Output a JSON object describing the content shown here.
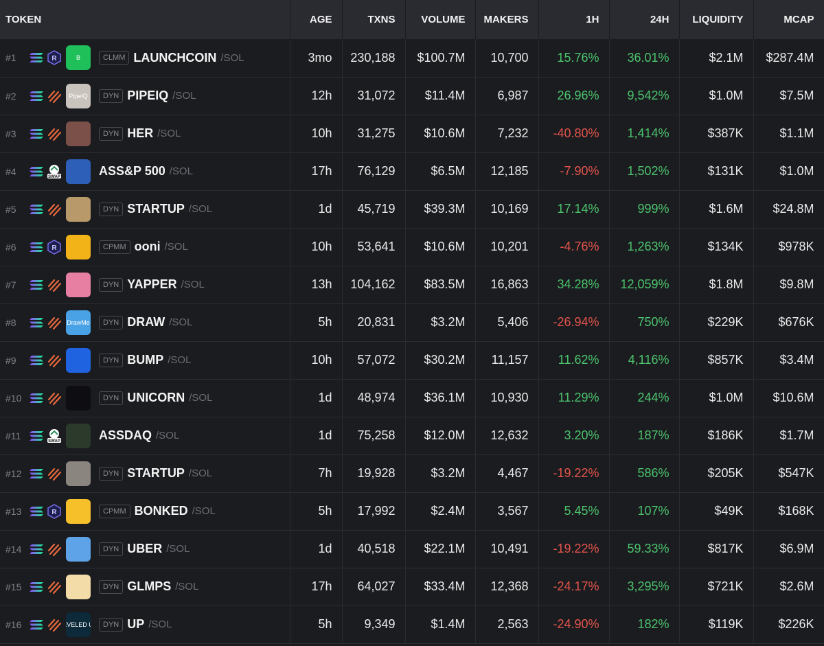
{
  "headers": [
    "TOKEN",
    "AGE",
    "TXNS",
    "VOLUME",
    "MAKERS",
    "1H",
    "24H",
    "LIQUIDITY",
    "MCAP"
  ],
  "colors": {
    "positive": "#4cc46d",
    "negative": "#e5544b"
  },
  "rows": [
    {
      "rank": "#1",
      "dex": "raydium-icon",
      "pool": "CLMM",
      "symbol": "LAUNCHCOIN",
      "quote": "/SOL",
      "age": "3mo",
      "txns": "230,188",
      "volume": "$100.7M",
      "makers": "10,700",
      "h1": "15.76%",
      "h24": "36.01%",
      "liquidity": "$2.1M",
      "mcap": "$287.4M",
      "avatar": "#1fc05a",
      "avatar_text": "B"
    },
    {
      "rank": "#2",
      "dex": "meteora-icon",
      "pool": "DYN",
      "symbol": "PIPEIQ",
      "quote": "/SOL",
      "age": "12h",
      "txns": "31,072",
      "volume": "$11.4M",
      "makers": "6,987",
      "h1": "26.96%",
      "h24": "9,542%",
      "liquidity": "$1.0M",
      "mcap": "$7.5M",
      "avatar": "#c9c3bd",
      "avatar_text": "PipeIQ"
    },
    {
      "rank": "#3",
      "dex": "meteora-icon",
      "pool": "DYN",
      "symbol": "HER",
      "quote": "/SOL",
      "age": "10h",
      "txns": "31,275",
      "volume": "$10.6M",
      "makers": "7,232",
      "h1": "-40.80%",
      "h24": "1,414%",
      "liquidity": "$387K",
      "mcap": "$1.1M",
      "avatar": "#7a5048",
      "avatar_text": ""
    },
    {
      "rank": "#4",
      "dex": "swap-icon",
      "pool": "",
      "symbol": "ASS&P 500",
      "quote": "/SOL",
      "age": "17h",
      "txns": "76,129",
      "volume": "$6.5M",
      "makers": "12,185",
      "h1": "-7.90%",
      "h24": "1,502%",
      "liquidity": "$131K",
      "mcap": "$1.0M",
      "avatar": "#2d5fb8",
      "avatar_text": ""
    },
    {
      "rank": "#5",
      "dex": "meteora-icon",
      "pool": "DYN",
      "symbol": "STARTUP",
      "quote": "/SOL",
      "age": "1d",
      "txns": "45,719",
      "volume": "$39.3M",
      "makers": "10,169",
      "h1": "17.14%",
      "h24": "999%",
      "liquidity": "$1.6M",
      "mcap": "$24.8M",
      "avatar": "#b89a6a",
      "avatar_text": ""
    },
    {
      "rank": "#6",
      "dex": "raydium-icon",
      "pool": "CPMM",
      "symbol": "ooni",
      "quote": "/SOL",
      "age": "10h",
      "txns": "53,641",
      "volume": "$10.6M",
      "makers": "10,201",
      "h1": "-4.76%",
      "h24": "1,263%",
      "liquidity": "$134K",
      "mcap": "$978K",
      "avatar": "#f2b318",
      "avatar_text": ""
    },
    {
      "rank": "#7",
      "dex": "meteora-icon",
      "pool": "DYN",
      "symbol": "YAPPER",
      "quote": "/SOL",
      "age": "13h",
      "txns": "104,162",
      "volume": "$83.5M",
      "makers": "16,863",
      "h1": "34.28%",
      "h24": "12,059%",
      "liquidity": "$1.8M",
      "mcap": "$9.8M",
      "avatar": "#e77fa3",
      "avatar_text": ""
    },
    {
      "rank": "#8",
      "dex": "meteora-icon",
      "pool": "DYN",
      "symbol": "DRAW",
      "quote": "/SOL",
      "age": "5h",
      "txns": "20,831",
      "volume": "$3.2M",
      "makers": "5,406",
      "h1": "-26.94%",
      "h24": "750%",
      "liquidity": "$229K",
      "mcap": "$676K",
      "avatar": "#4aa2e6",
      "avatar_text": "DrawMe"
    },
    {
      "rank": "#9",
      "dex": "meteora-icon",
      "pool": "DYN",
      "symbol": "BUMP",
      "quote": "/SOL",
      "age": "10h",
      "txns": "57,072",
      "volume": "$30.2M",
      "makers": "11,157",
      "h1": "11.62%",
      "h24": "4,116%",
      "liquidity": "$857K",
      "mcap": "$3.4M",
      "avatar": "#1f63e0",
      "avatar_text": ""
    },
    {
      "rank": "#10",
      "dex": "meteora-icon",
      "pool": "DYN",
      "symbol": "UNICORN",
      "quote": "/SOL",
      "age": "1d",
      "txns": "48,974",
      "volume": "$36.1M",
      "makers": "10,930",
      "h1": "11.29%",
      "h24": "244%",
      "liquidity": "$1.0M",
      "mcap": "$10.6M",
      "avatar": "#0d0d12",
      "avatar_text": ""
    },
    {
      "rank": "#11",
      "dex": "swap-icon",
      "pool": "",
      "symbol": "ASSDAQ",
      "quote": "/SOL",
      "age": "1d",
      "txns": "75,258",
      "volume": "$12.0M",
      "makers": "12,632",
      "h1": "3.20%",
      "h24": "187%",
      "liquidity": "$186K",
      "mcap": "$1.7M",
      "avatar": "#2b3a2a",
      "avatar_text": ""
    },
    {
      "rank": "#12",
      "dex": "meteora-icon",
      "pool": "DYN",
      "symbol": "STARTUP",
      "quote": "/SOL",
      "age": "7h",
      "txns": "19,928",
      "volume": "$3.2M",
      "makers": "4,467",
      "h1": "-19.22%",
      "h24": "586%",
      "liquidity": "$205K",
      "mcap": "$547K",
      "avatar": "#8b8580",
      "avatar_text": ""
    },
    {
      "rank": "#13",
      "dex": "raydium-icon",
      "pool": "CPMM",
      "symbol": "BONKED",
      "quote": "/SOL",
      "age": "5h",
      "txns": "17,992",
      "volume": "$2.4M",
      "makers": "3,567",
      "h1": "5.45%",
      "h24": "107%",
      "liquidity": "$49K",
      "mcap": "$168K",
      "avatar": "#f5c02a",
      "avatar_text": ""
    },
    {
      "rank": "#14",
      "dex": "meteora-icon",
      "pool": "DYN",
      "symbol": "UBER",
      "quote": "/SOL",
      "age": "1d",
      "txns": "40,518",
      "volume": "$22.1M",
      "makers": "10,491",
      "h1": "-19.22%",
      "h24": "59.33%",
      "liquidity": "$817K",
      "mcap": "$6.9M",
      "avatar": "#5ea3e8",
      "avatar_text": ""
    },
    {
      "rank": "#15",
      "dex": "meteora-icon",
      "pool": "DYN",
      "symbol": "GLMPS",
      "quote": "/SOL",
      "age": "17h",
      "txns": "64,027",
      "volume": "$33.4M",
      "makers": "12,368",
      "h1": "-24.17%",
      "h24": "3,295%",
      "liquidity": "$721K",
      "mcap": "$2.6M",
      "avatar": "#f3dca8",
      "avatar_text": ""
    },
    {
      "rank": "#16",
      "dex": "meteora-icon",
      "pool": "DYN",
      "symbol": "UP",
      "quote": "/SOL",
      "age": "5h",
      "txns": "9,349",
      "volume": "$1.4M",
      "makers": "2,563",
      "h1": "-24.90%",
      "h24": "182%",
      "liquidity": "$119K",
      "mcap": "$226K",
      "avatar": "#0c2a3a",
      "avatar_text": "LEVELED UP"
    }
  ]
}
